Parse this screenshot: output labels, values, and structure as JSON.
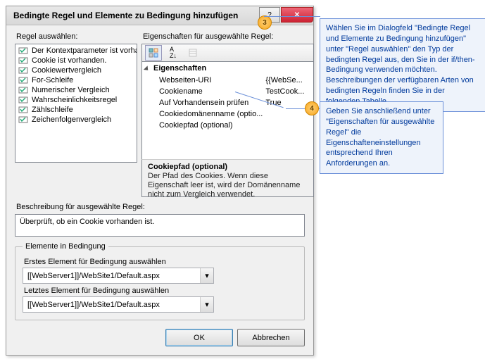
{
  "dialog": {
    "title": "Bedingte Regel und Elemente zu Bedingung hinzufügen",
    "labels": {
      "select_rule": "Regel auswählen:",
      "properties_for_rule": "Eigenschaften für ausgewählte Regel:",
      "description_for_rule": "Beschreibung für ausgewählte Regel:",
      "elements_in_condition": "Elemente in Bedingung",
      "first_element": "Erstes Element für Bedingung auswählen",
      "last_element": "Letztes Element für Bedingung auswählen"
    },
    "rules": [
      "Der Kontextparameter ist vorhanden.",
      "Cookie ist vorhanden.",
      "Cookiewertvergleich",
      "For-Schleife",
      "Numerischer Vergleich",
      "Wahrscheinlichkeitsregel",
      "Zählschleife",
      "Zeichenfolgenvergleich"
    ],
    "selected_rule_index": 1,
    "prop_grid": {
      "category": "Eigenschaften",
      "rows": [
        {
          "name": "Webseiten-URI",
          "value": "{{WebSe..."
        },
        {
          "name": "Cookiename",
          "value": "TestCook..."
        },
        {
          "name": "Auf Vorhandensein prüfen",
          "value": "True"
        },
        {
          "name": "Cookiedomänenname (optio...",
          "value": ""
        },
        {
          "name": "Cookiepfad (optional)",
          "value": ""
        }
      ],
      "help": {
        "title": "Cookiepfad (optional)",
        "text": "Der Pfad des Cookies. Wenn diese Eigenschaft leer ist, wird der Domänenname nicht zum Vergleich verwendet."
      }
    },
    "toolbar": {
      "categorized": "⊞",
      "alpha": "A↓",
      "pages": "▤"
    },
    "description": "Überprüft, ob ein Cookie vorhanden ist.",
    "combos": {
      "first": "[[WebServer1]]/WebSite1/Default.aspx",
      "last": "[[WebServer1]]/WebSite1/Default.aspx"
    },
    "buttons": {
      "ok": "OK",
      "cancel": "Abbrechen"
    }
  },
  "callouts": {
    "num3": "3",
    "num4": "4",
    "text1": "Wählen Sie im Dialogfeld \"Bedingte Regel und Elemente zu Bedingung hinzufügen\" unter \"Regel auswählen\" den Typ der bedingten Regel aus, den Sie in der if/then-Bedingung verwenden möchten. Beschreibungen der verfügbaren Arten von bedingten Regeln finden Sie in der folgenden Tabelle.",
    "text2": "Geben Sie anschließend unter \"Eigenschaften für ausgewählte Regel\" die Eigenschafteneinstellungen entsprechend Ihren Anforderungen an."
  }
}
